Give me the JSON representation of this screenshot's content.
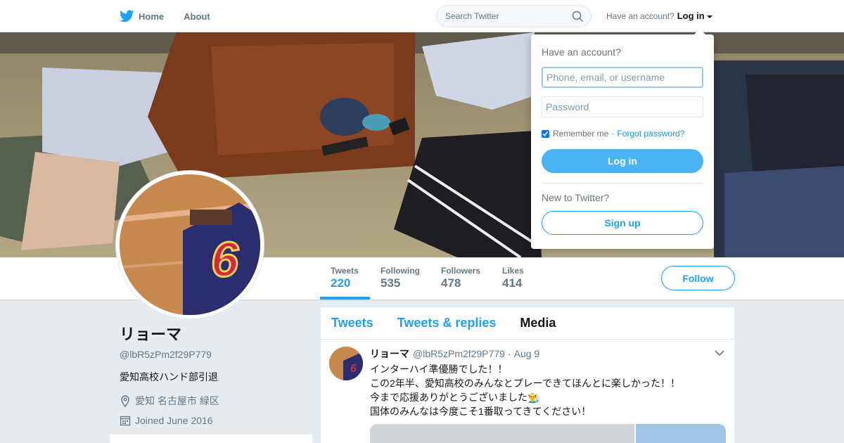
{
  "topbar": {
    "nav": [
      {
        "label": "Home",
        "icon": "twitter-bird-icon"
      },
      {
        "label": "About"
      }
    ],
    "search_placeholder": "Search Twitter",
    "have_account": "Have an account?",
    "login_label": "Log in"
  },
  "login_dropdown": {
    "title": "Have an account?",
    "username_placeholder": "Phone, email, or username",
    "password_placeholder": "Password",
    "remember_label": "Remember me",
    "separator": "·",
    "forgot_label": "Forgot password?",
    "login_button": "Log in",
    "new_label": "New to Twitter?",
    "signup_button": "Sign up"
  },
  "stats": [
    {
      "label": "Tweets",
      "value": "220"
    },
    {
      "label": "Following",
      "value": "535"
    },
    {
      "label": "Followers",
      "value": "478"
    },
    {
      "label": "Likes",
      "value": "414"
    }
  ],
  "follow_label": "Follow",
  "profile": {
    "name": "リョーマ",
    "handle": "@lbR5zPm2f29P779",
    "bio": "愛知高校ハンド部引退",
    "location": "愛知 名古屋市 緑区",
    "joined": "Joined June 2016"
  },
  "tabs": [
    {
      "label": "Tweets"
    },
    {
      "label": "Tweets & replies"
    },
    {
      "label": "Media"
    }
  ],
  "tweet": {
    "name": "リョーマ",
    "handle": "@lbR5zPm2f29P779",
    "dot": "·",
    "time": "Aug 9",
    "lines": [
      "インターハイ準優勝でした！！",
      "この2年半、愛知高校のみんなとプレーできてほんとに楽しかった！！",
      "今まで応援ありがとうございました👨‍🌾",
      "国体のみんなは今度こそ1番取ってきてください！"
    ]
  },
  "colors": {
    "accent": "#1da1f2",
    "background": "#e6ecf0",
    "login_button": "#4ab3f4"
  }
}
